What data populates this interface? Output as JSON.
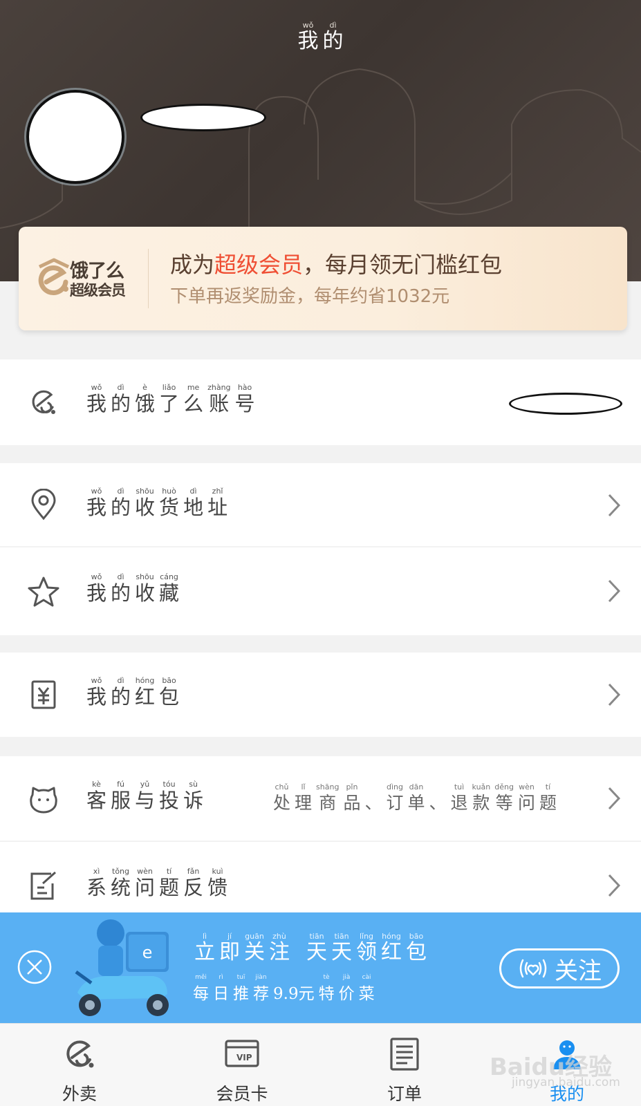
{
  "header": {
    "title": [
      {
        "py": "wǒ",
        "hz": "我"
      },
      {
        "py": "dì",
        "hz": "的"
      }
    ]
  },
  "vip": {
    "logo_line1": "饿了么",
    "logo_line2": "超级会员",
    "main_pre": "成为",
    "main_highlight": "超级会员",
    "main_post": "，每月领无门槛红包",
    "sub": "下单再返奖励金，每年约省1032元"
  },
  "menu": {
    "account": [
      {
        "py": "wǒ",
        "hz": "我"
      },
      {
        "py": "dì",
        "hz": "的"
      },
      {
        "py": "è",
        "hz": "饿"
      },
      {
        "py": "liǎo",
        "hz": "了"
      },
      {
        "py": "me",
        "hz": "么"
      },
      {
        "py": "zhàng",
        "hz": "账"
      },
      {
        "py": "hào",
        "hz": "号"
      }
    ],
    "address": [
      {
        "py": "wǒ",
        "hz": "我"
      },
      {
        "py": "dì",
        "hz": "的"
      },
      {
        "py": "shōu",
        "hz": "收"
      },
      {
        "py": "huò",
        "hz": "货"
      },
      {
        "py": "dì",
        "hz": "地"
      },
      {
        "py": "zhǐ",
        "hz": "址"
      }
    ],
    "favorites": [
      {
        "py": "wǒ",
        "hz": "我"
      },
      {
        "py": "dì",
        "hz": "的"
      },
      {
        "py": "shōu",
        "hz": "收"
      },
      {
        "py": "cáng",
        "hz": "藏"
      }
    ],
    "red_packet": [
      {
        "py": "wǒ",
        "hz": "我"
      },
      {
        "py": "dì",
        "hz": "的"
      },
      {
        "py": "hóng",
        "hz": "红"
      },
      {
        "py": "bāo",
        "hz": "包"
      }
    ],
    "service": [
      {
        "py": "kè",
        "hz": "客"
      },
      {
        "py": "fú",
        "hz": "服"
      },
      {
        "py": "yǔ",
        "hz": "与"
      },
      {
        "py": "tóu",
        "hz": "投"
      },
      {
        "py": "sù",
        "hz": "诉"
      }
    ],
    "service_hint": [
      {
        "py": "chǔ",
        "hz": "处"
      },
      {
        "py": "lǐ",
        "hz": "理"
      },
      {
        "py": "shāng",
        "hz": "商"
      },
      {
        "py": "pǐn",
        "hz": "品"
      },
      {
        "py": "",
        "hz": "、"
      },
      {
        "py": "dìng",
        "hz": "订"
      },
      {
        "py": "dān",
        "hz": "单"
      },
      {
        "py": "",
        "hz": "、"
      },
      {
        "py": "tuì",
        "hz": "退"
      },
      {
        "py": "kuǎn",
        "hz": "款"
      },
      {
        "py": "děng",
        "hz": "等"
      },
      {
        "py": "wèn",
        "hz": "问"
      },
      {
        "py": "tí",
        "hz": "题"
      }
    ],
    "feedback": [
      {
        "py": "xì",
        "hz": "系"
      },
      {
        "py": "tǒng",
        "hz": "统"
      },
      {
        "py": "wèn",
        "hz": "问"
      },
      {
        "py": "tí",
        "hz": "题"
      },
      {
        "py": "fǎn",
        "hz": "反"
      },
      {
        "py": "kuì",
        "hz": "馈"
      }
    ]
  },
  "follow_banner": {
    "line1a": [
      {
        "py": "lì",
        "hz": "立"
      },
      {
        "py": "jí",
        "hz": "即"
      },
      {
        "py": "guān",
        "hz": "关"
      },
      {
        "py": "zhù",
        "hz": "注"
      }
    ],
    "line1b": [
      {
        "py": "tiān",
        "hz": "天"
      },
      {
        "py": "tiān",
        "hz": "天"
      },
      {
        "py": "lǐng",
        "hz": "领"
      },
      {
        "py": "hóng",
        "hz": "红"
      },
      {
        "py": "bāo",
        "hz": "包"
      }
    ],
    "line2": [
      {
        "py": "měi",
        "hz": "每"
      },
      {
        "py": "rì",
        "hz": "日"
      },
      {
        "py": "tuī",
        "hz": "推"
      },
      {
        "py": "jiàn",
        "hz": "荐"
      },
      {
        "py": "",
        "hz": "9.9元"
      },
      {
        "py": "tè",
        "hz": "特"
      },
      {
        "py": "jià",
        "hz": "价"
      },
      {
        "py": "cài",
        "hz": "菜"
      }
    ],
    "button_label": "关注",
    "bg_color": "#59b0f3"
  },
  "tabs": [
    {
      "label": "外卖",
      "icon": "takeout-icon",
      "active": false
    },
    {
      "label": "会员卡",
      "icon": "vip-card-icon",
      "active": false
    },
    {
      "label": "订单",
      "icon": "order-icon",
      "active": false
    },
    {
      "label": "我的",
      "icon": "profile-icon",
      "active": true
    }
  ],
  "watermark": {
    "line1": "Baidu经验",
    "line2": "jingyan.baidu.com"
  },
  "colors": {
    "accent": "#1a8ff0",
    "highlight": "#ef4e33",
    "header_bg": "#3d3531"
  }
}
